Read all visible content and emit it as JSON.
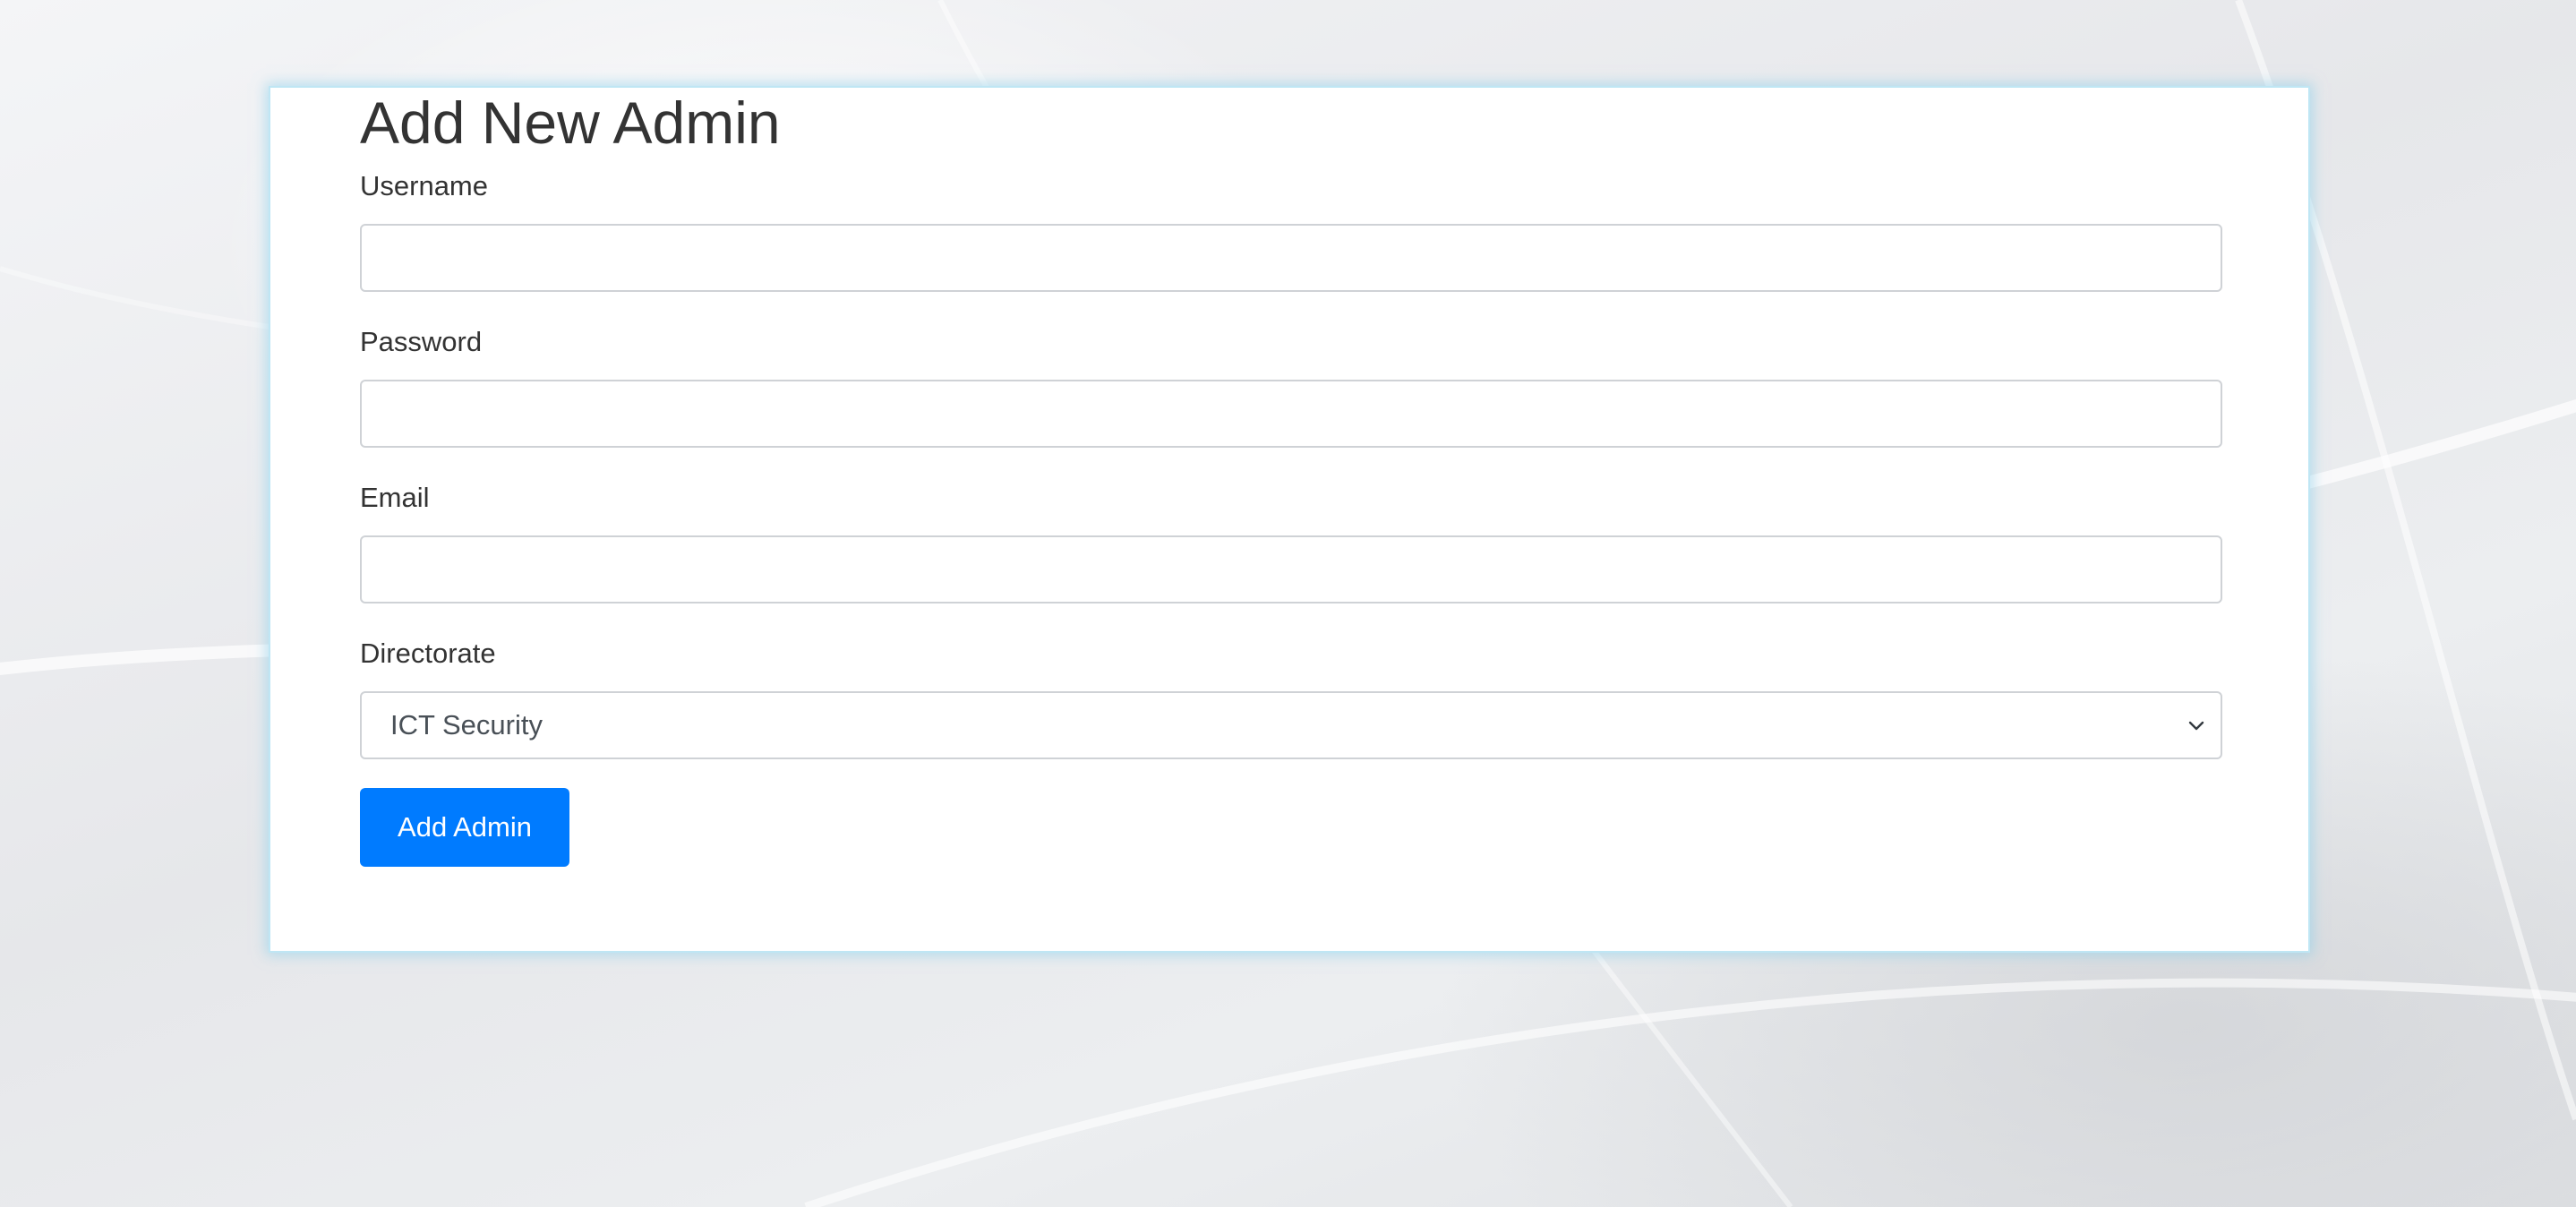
{
  "form": {
    "title": "Add New Admin",
    "username": {
      "label": "Username",
      "value": ""
    },
    "password": {
      "label": "Password",
      "value": ""
    },
    "email": {
      "label": "Email",
      "value": ""
    },
    "directorate": {
      "label": "Directorate",
      "selected": "ICT Security"
    },
    "submit_label": "Add Admin"
  },
  "icons": {
    "select_arrow": "chevron-down-icon"
  },
  "colors": {
    "primary_button": "#007bff",
    "card_glow": "#87ceeb",
    "text": "#333333"
  }
}
